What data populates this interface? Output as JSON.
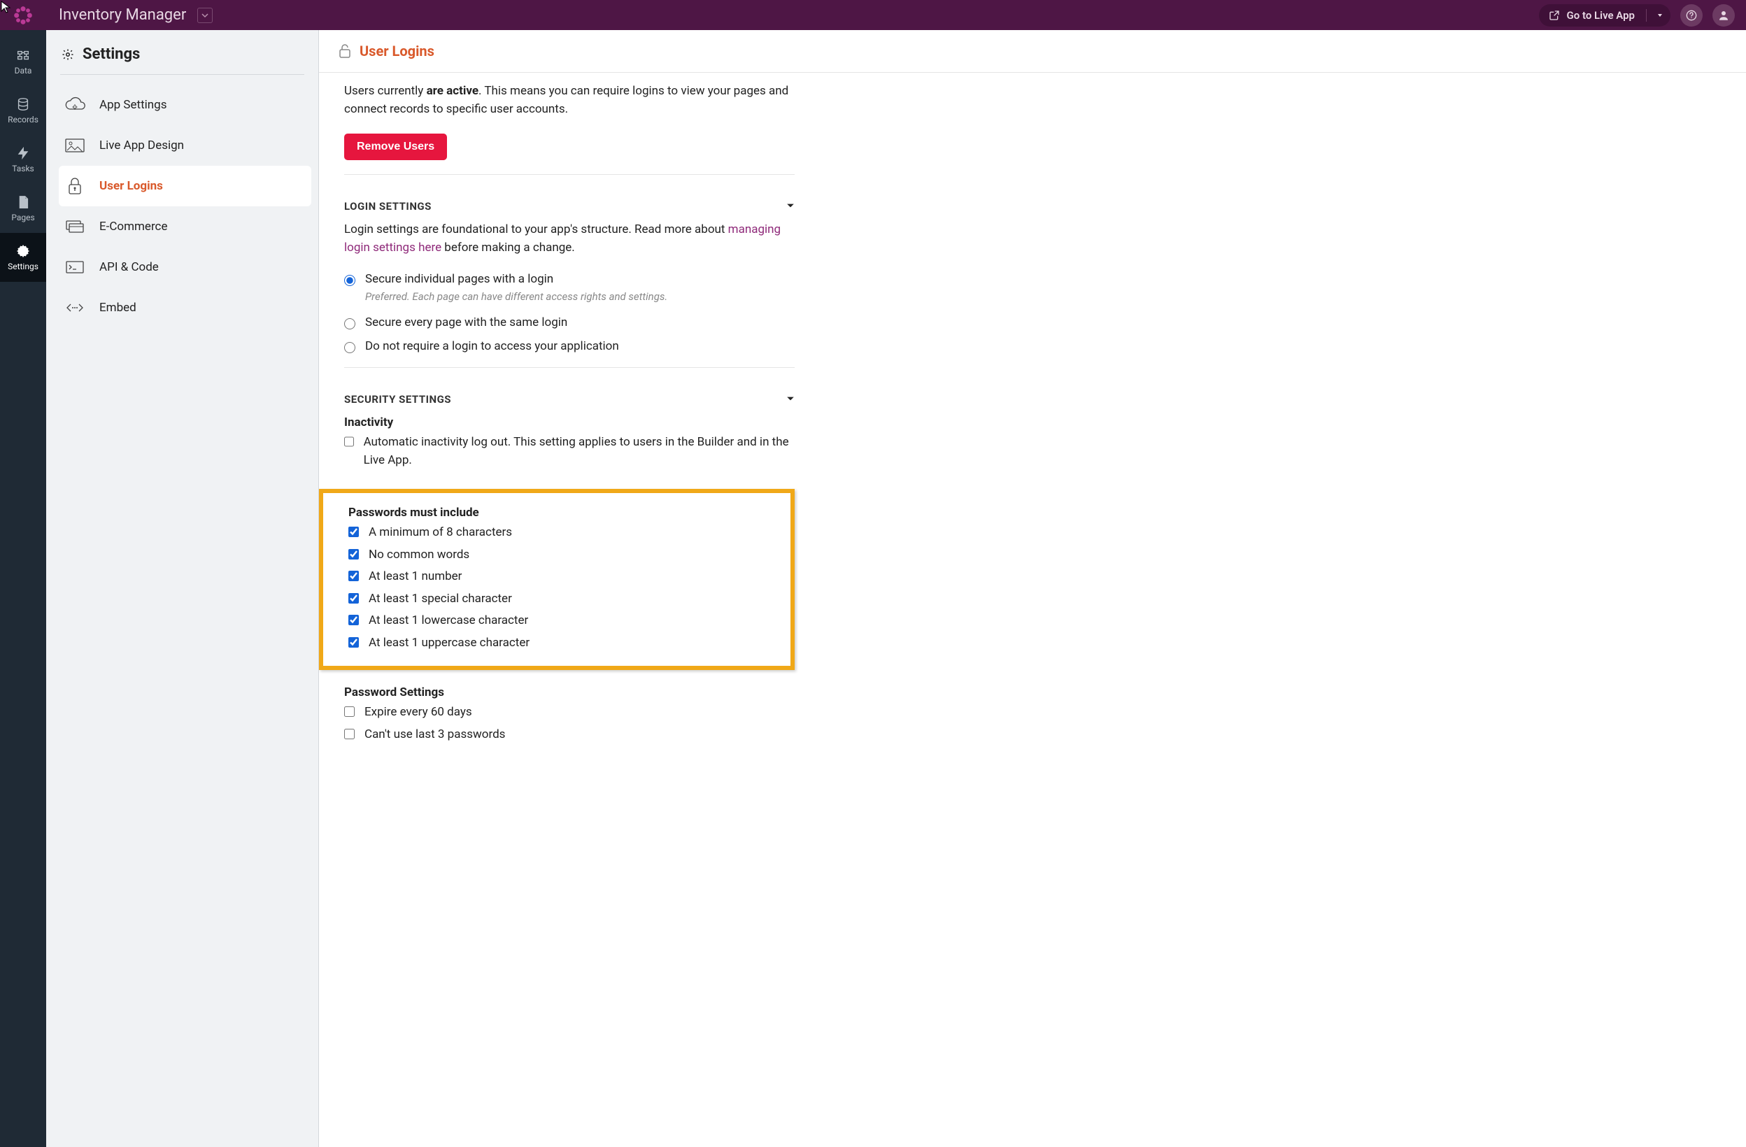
{
  "app_title": "Inventory Manager",
  "topbar": {
    "go_live": "Go to Live App"
  },
  "rail": [
    {
      "id": "data",
      "label": "Data"
    },
    {
      "id": "records",
      "label": "Records"
    },
    {
      "id": "tasks",
      "label": "Tasks"
    },
    {
      "id": "pages",
      "label": "Pages"
    },
    {
      "id": "settings",
      "label": "Settings"
    }
  ],
  "settings": {
    "title": "Settings",
    "items": [
      {
        "id": "app-settings",
        "label": "App Settings"
      },
      {
        "id": "live-app-design",
        "label": "Live App Design"
      },
      {
        "id": "user-logins",
        "label": "User Logins"
      },
      {
        "id": "ecommerce",
        "label": "E-Commerce"
      },
      {
        "id": "api-code",
        "label": "API & Code"
      },
      {
        "id": "embed",
        "label": "Embed"
      }
    ]
  },
  "page": {
    "title": "User Logins",
    "intro_pre": "Users currently ",
    "intro_bold": "are active",
    "intro_post": ". This means you can require logins to view your pages and connect records to specific user accounts.",
    "remove_btn": "Remove Users",
    "login_section": {
      "title": "LOGIN SETTINGS",
      "desc_pre": "Login settings are foundational to your app's structure. Read more about ",
      "desc_link": "managing login settings here",
      "desc_post": " before making a change.",
      "options": [
        {
          "label": "Secure individual pages with a login",
          "hint": "Preferred. Each page can have different access rights and settings.",
          "checked": true
        },
        {
          "label": "Secure every page with the same login",
          "checked": false
        },
        {
          "label": "Do not require a login to access your application",
          "checked": false
        }
      ]
    },
    "security_section": {
      "title": "SECURITY SETTINGS",
      "inactivity": {
        "heading": "Inactivity",
        "label": "Automatic inactivity log out. This setting applies to users in the Builder and in the Live App.",
        "checked": false
      },
      "passwords": {
        "heading": "Passwords must include",
        "rules": [
          {
            "label": "A minimum of 8 characters",
            "checked": true
          },
          {
            "label": "No common words",
            "checked": true
          },
          {
            "label": "At least 1 number",
            "checked": true
          },
          {
            "label": "At least 1 special character",
            "checked": true
          },
          {
            "label": "At least 1 lowercase character",
            "checked": true
          },
          {
            "label": "At least 1 uppercase character",
            "checked": true
          }
        ]
      },
      "pw_settings": {
        "heading": "Password Settings",
        "rules": [
          {
            "label": "Expire every 60 days",
            "checked": false
          },
          {
            "label": "Can't use last 3 passwords",
            "checked": false
          }
        ]
      }
    }
  }
}
